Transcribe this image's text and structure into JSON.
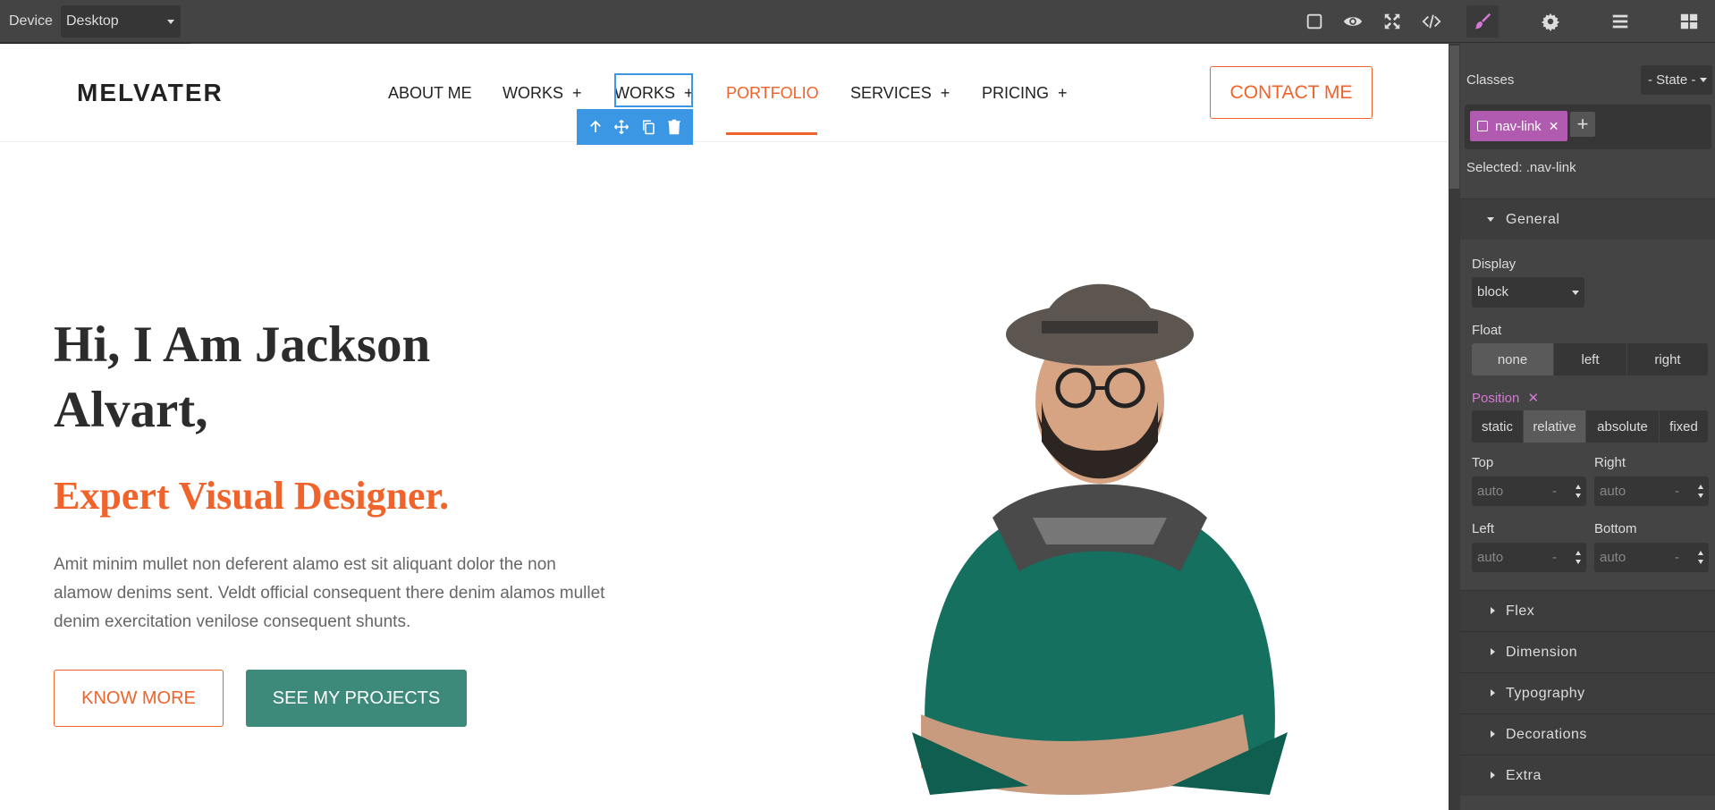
{
  "topbar": {
    "device_label": "Device",
    "device_value": "Desktop"
  },
  "site": {
    "logo": "MELVATER",
    "nav": [
      "ABOUT ME",
      "WORKS  +",
      "WORKS  +",
      "PORTFOLIO",
      "SERVICES  +",
      "PRICING  +"
    ],
    "contact": "CONTACT ME"
  },
  "hero": {
    "title": "Hi, I Am Jackson Alvart,",
    "subtitle": "Expert Visual Designer.",
    "text": "Amit minim mullet non deferent alamo est sit aliquant dolor the non alamow denims sent. Veldt official consequent there denim alamos mullet denim exercitation venilose consequent shunts.",
    "btn_know": "KNOW MORE",
    "btn_projects": "SEE MY PROJECTS"
  },
  "panel": {
    "classes_label": "Classes",
    "state": "- State -",
    "class_tag": "nav-link",
    "selected": "Selected:  .nav-link",
    "general": "General",
    "display_label": "Display",
    "display_value": "block",
    "float_label": "Float",
    "float_options": [
      "none",
      "left",
      "right"
    ],
    "position_label": "Position",
    "position_options": [
      "static",
      "relative",
      "absolute",
      "fixed"
    ],
    "top_label": "Top",
    "right_label": "Right",
    "left_label": "Left",
    "bottom_label": "Bottom",
    "auto": "auto",
    "unit": "-",
    "sections": [
      "Flex",
      "Dimension",
      "Typography",
      "Decorations",
      "Extra"
    ]
  },
  "colors": {
    "accent": "#f0632a",
    "teal": "#3d8a7a",
    "selection": "#3b97e3",
    "class_tag": "#b05ab0"
  }
}
